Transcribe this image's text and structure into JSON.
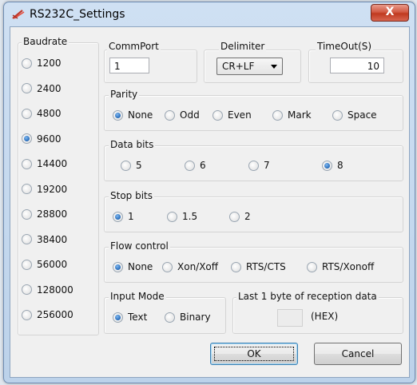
{
  "window": {
    "title": "RS232C_Settings",
    "close_label": "X"
  },
  "baudrate": {
    "label": "Baudrate",
    "options": [
      "1200",
      "2400",
      "4800",
      "9600",
      "14400",
      "19200",
      "28800",
      "38400",
      "56000",
      "128000",
      "256000"
    ],
    "selected": "9600"
  },
  "commport": {
    "label": "CommPort",
    "value": "1"
  },
  "delimiter": {
    "label": "Delimiter",
    "value": "CR+LF"
  },
  "timeout": {
    "label": "TimeOut(S)",
    "value": "10"
  },
  "parity": {
    "label": "Parity",
    "options": [
      "None",
      "Odd",
      "Even",
      "Mark",
      "Space"
    ],
    "selected": "None"
  },
  "data_bits": {
    "label": "Data bits",
    "options": [
      "5",
      "6",
      "7",
      "8"
    ],
    "selected": "8"
  },
  "stop_bits": {
    "label": "Stop bits",
    "options": [
      "1",
      "1.5",
      "2"
    ],
    "selected": "1"
  },
  "flow_control": {
    "label": "Flow control",
    "options": [
      "None",
      "Xon/Xoff",
      "RTS/CTS",
      "RTS/Xonoff"
    ],
    "selected": "None"
  },
  "input_mode": {
    "label": "Input Mode",
    "options": [
      "Text",
      "Binary"
    ],
    "selected": "Text"
  },
  "last_byte": {
    "label": "Last 1 byte of reception data",
    "hex_label": "(HEX)",
    "value": ""
  },
  "buttons": {
    "ok": "OK",
    "cancel": "Cancel"
  }
}
